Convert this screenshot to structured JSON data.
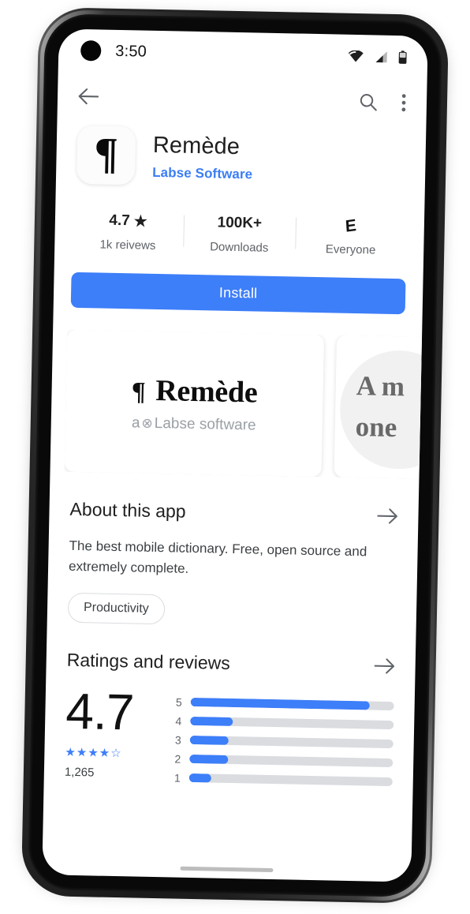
{
  "status_bar": {
    "time": "3:50",
    "icons": [
      "wifi-icon",
      "cellular-signal-icon",
      "battery-icon"
    ]
  },
  "app_bar": {
    "back_icon": "back-arrow-icon",
    "search_icon": "search-icon",
    "overflow_icon": "overflow-menu-icon"
  },
  "app": {
    "icon_glyph": "¶",
    "title": "Remède",
    "developer": "Labse Software"
  },
  "stats": [
    {
      "top": "4.7",
      "star": "★",
      "sub": "1k reivews",
      "type": "rating"
    },
    {
      "top": "100K+",
      "sub": "Downloads",
      "type": "downloads"
    },
    {
      "top": "E",
      "sub": "Everyone",
      "type": "content-rating"
    }
  ],
  "install": {
    "label": "Install",
    "color": "#3d7ef9"
  },
  "screenshots": [
    {
      "mark": "¶",
      "title": "Remède",
      "subtitle_pre": "a ",
      "subtitle_mark": "⊗",
      "subtitle_post": "Labse software"
    },
    {
      "line1": "A m",
      "line2": "one"
    }
  ],
  "about": {
    "title": "About this app",
    "arrow_icon": "arrow-right-icon",
    "description": "The best mobile dictionary. Free, open source and extremely complete.",
    "category_chip": "Productivity"
  },
  "ratings": {
    "title": "Ratings and reviews",
    "arrow_icon": "arrow-right-icon",
    "score": "4.7",
    "stars": "★★★★☆",
    "count": "1,265",
    "histogram": [
      {
        "label": "5",
        "percent": 88
      },
      {
        "label": "4",
        "percent": 21
      },
      {
        "label": "3",
        "percent": 19
      },
      {
        "label": "2",
        "percent": 19
      },
      {
        "label": "1",
        "percent": 11
      }
    ]
  },
  "colors": {
    "accent": "#3d7ef9",
    "track": "#dadce0",
    "text_primary": "#1f1f1f",
    "text_secondary": "#5f6368"
  }
}
